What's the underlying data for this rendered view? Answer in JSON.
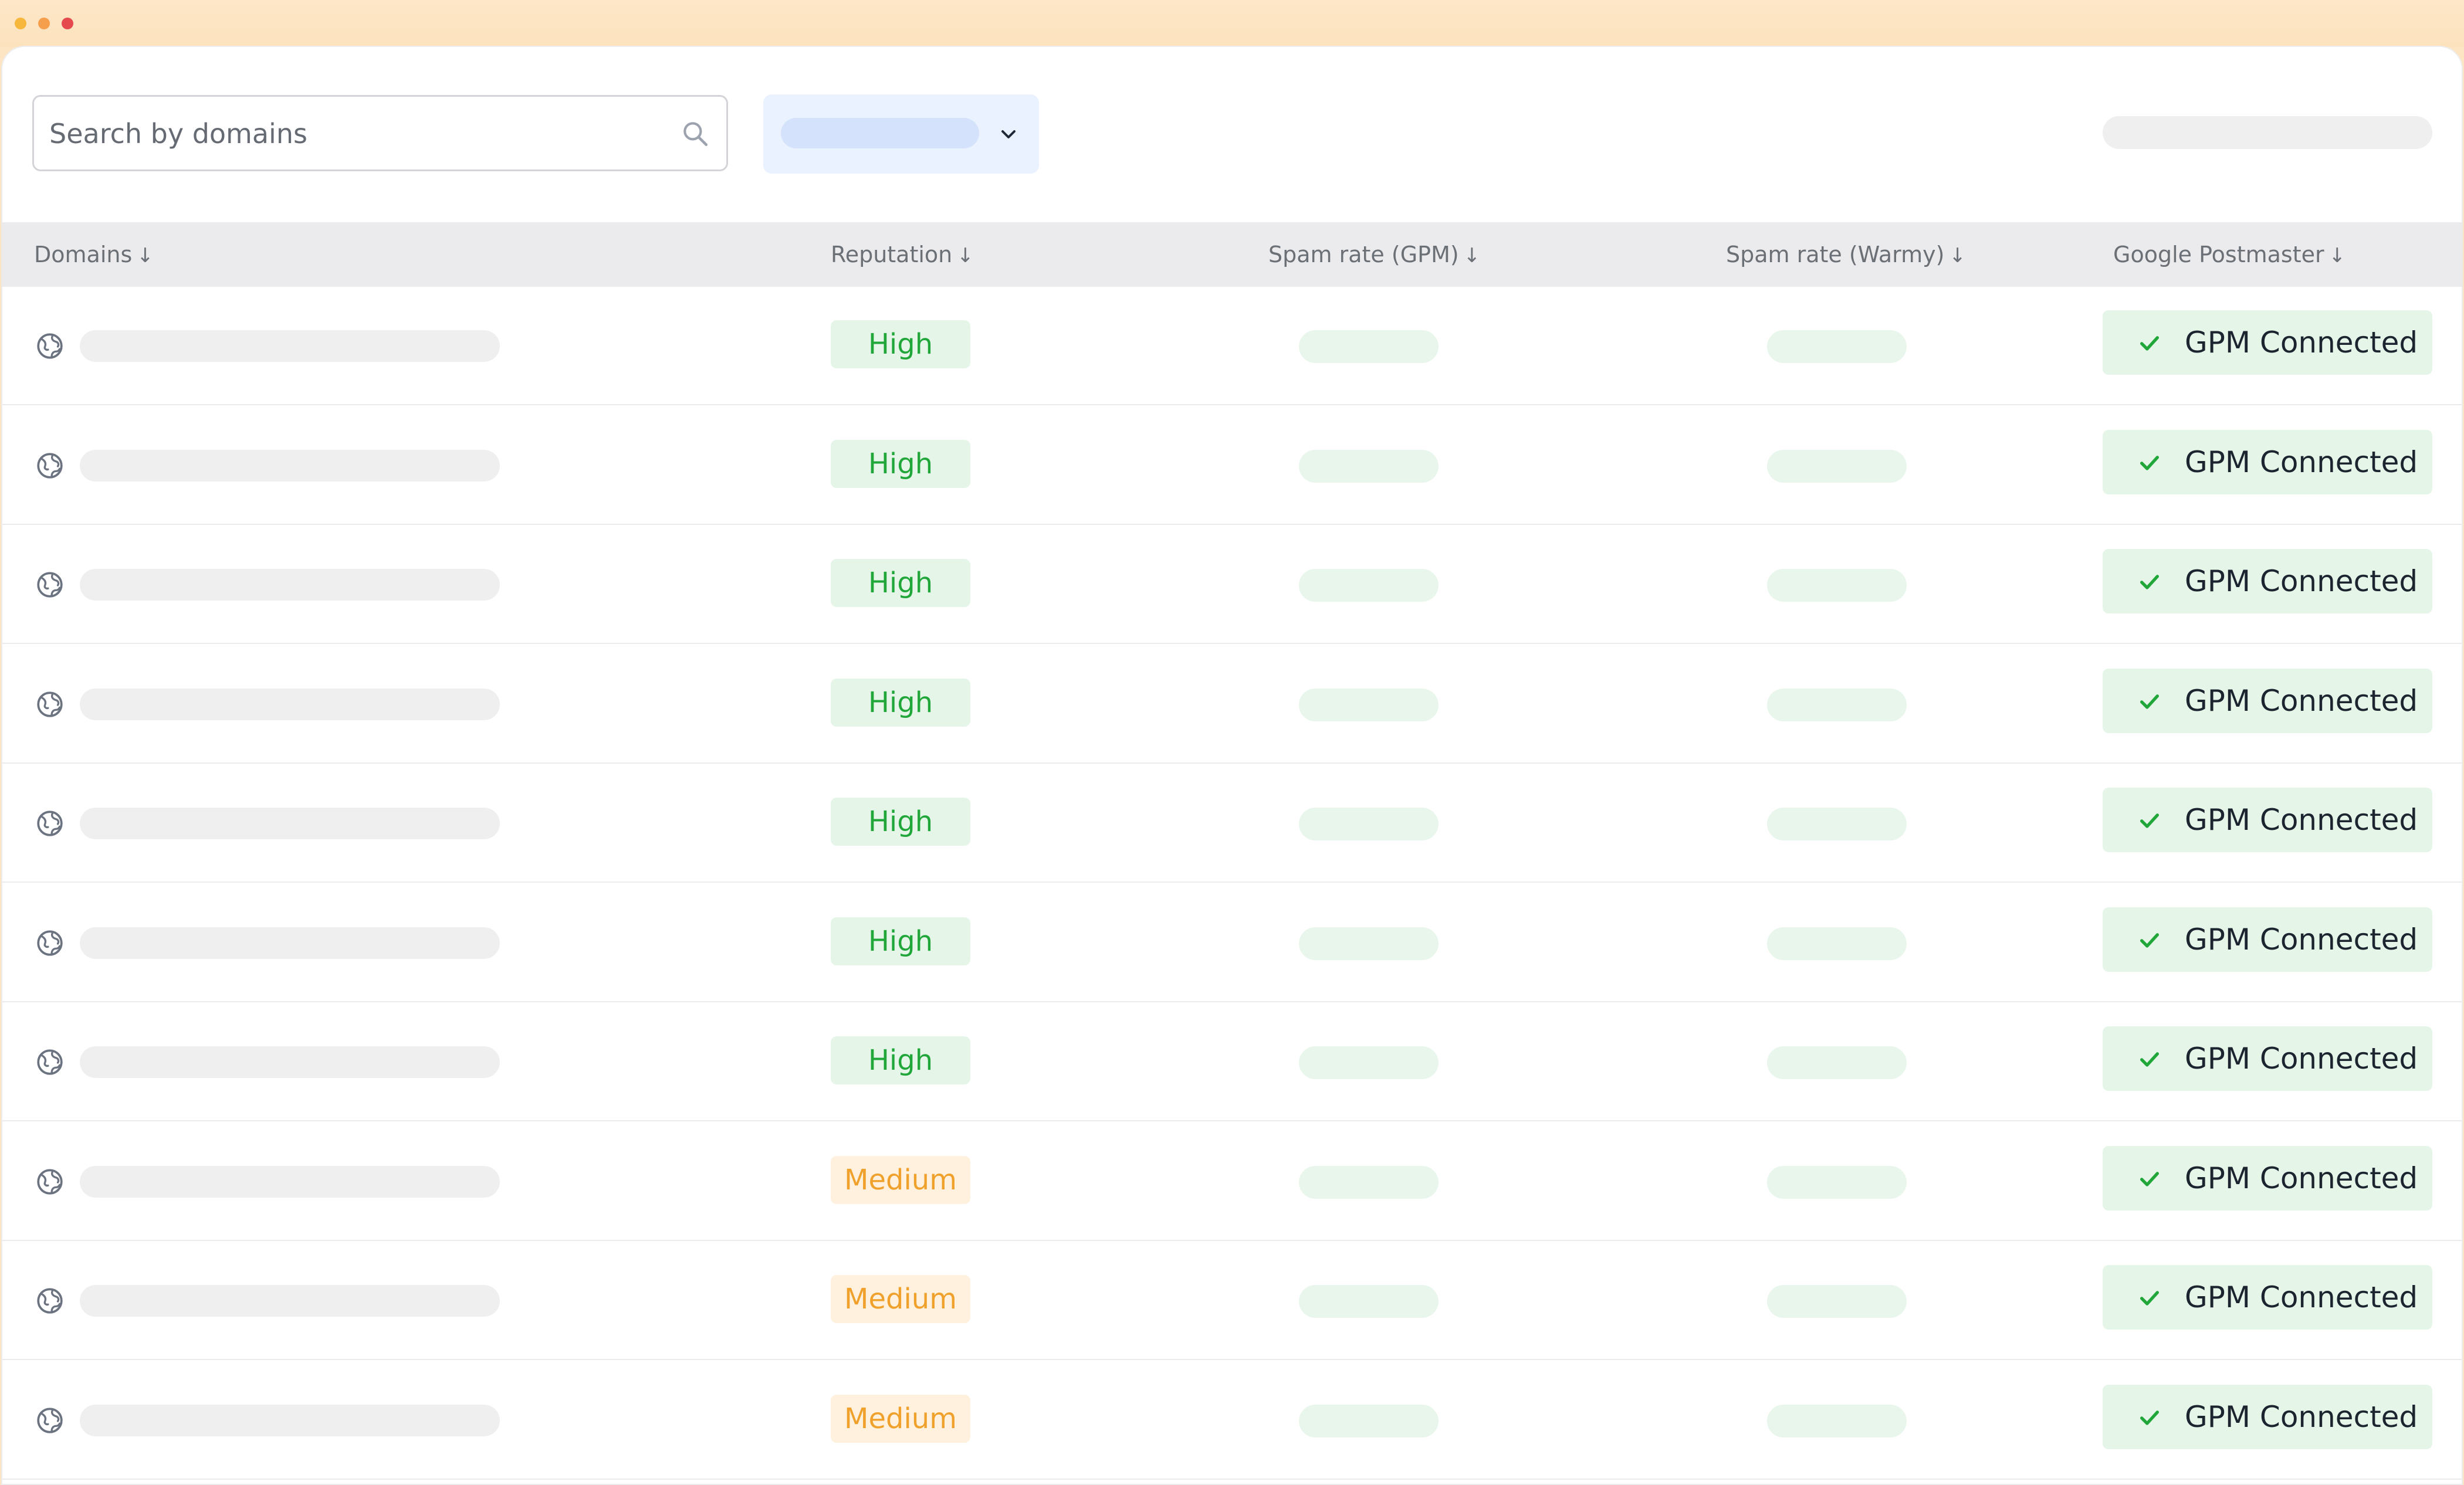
{
  "window": {
    "dots": [
      {
        "name": "window-dot-yellow",
        "color": "#f6b73c"
      },
      {
        "name": "window-dot-orange",
        "color": "#f59e4b"
      },
      {
        "name": "window-dot-red",
        "color": "#e5484d"
      }
    ]
  },
  "toolbar": {
    "search_placeholder": "Search by domains",
    "search_icon": "search-icon",
    "filter_icon": "chevron-down-icon"
  },
  "columns": {
    "domains": "Domains",
    "reputation": "Reputation",
    "spam_gpm": "Spam rate (GPM)",
    "spam_warmy": "Spam rate (Warmy)",
    "postmaster": "Google Postmaster",
    "sort_arrow": "↓"
  },
  "rows": [
    {
      "reputation": "High",
      "reputation_level": "high",
      "status": "GPM Connected"
    },
    {
      "reputation": "High",
      "reputation_level": "high",
      "status": "GPM Connected"
    },
    {
      "reputation": "High",
      "reputation_level": "high",
      "status": "GPM Connected"
    },
    {
      "reputation": "High",
      "reputation_level": "high",
      "status": "GPM Connected"
    },
    {
      "reputation": "High",
      "reputation_level": "high",
      "status": "GPM Connected"
    },
    {
      "reputation": "High",
      "reputation_level": "high",
      "status": "GPM Connected"
    },
    {
      "reputation": "High",
      "reputation_level": "high",
      "status": "GPM Connected"
    },
    {
      "reputation": "Medium",
      "reputation_level": "medium",
      "status": "GPM Connected"
    },
    {
      "reputation": "Medium",
      "reputation_level": "medium",
      "status": "GPM Connected"
    },
    {
      "reputation": "Medium",
      "reputation_level": "medium",
      "status": "GPM Connected"
    }
  ],
  "colors": {
    "high_text": "#21a63a",
    "medium_text": "#f0a12b",
    "connected_bg": "#e5f6e9",
    "check": "#21a63a"
  }
}
